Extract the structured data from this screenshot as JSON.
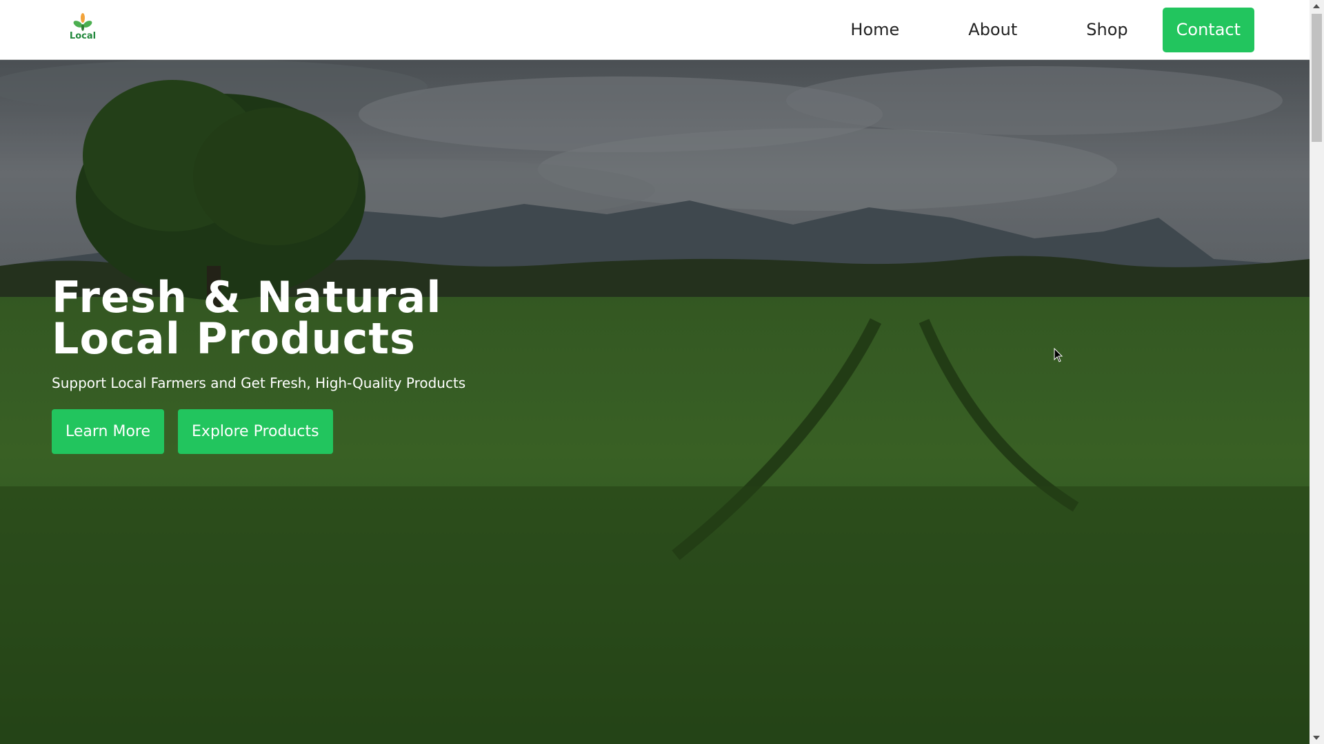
{
  "brand": {
    "logo_text": "Local",
    "accent": "#22c55e"
  },
  "nav": {
    "items": [
      {
        "label": "Home"
      },
      {
        "label": "About"
      },
      {
        "label": "Shop"
      }
    ],
    "contact_label": "Contact"
  },
  "hero": {
    "title_line1": "Fresh & Natural",
    "title_line2": "Local Products",
    "subtitle": "Support Local Farmers and Get Fresh, High-Quality Products",
    "primary_button": "Learn More",
    "secondary_button": "Explore Products",
    "background": "green wheat field with tree and hills under cloudy sky"
  }
}
